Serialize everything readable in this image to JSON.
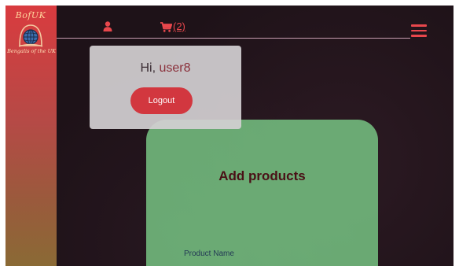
{
  "brand": {
    "logo_top": "BofUK",
    "logo_sub": "Bengalis of the UK"
  },
  "nav": {
    "user_icon": "user-icon",
    "cart_icon": "cart-icon",
    "cart_count": "(2)",
    "menu_icon": "hamburger-menu-icon",
    "accent_color": "#e8474c"
  },
  "user_popup": {
    "greeting_prefix": "Hi, ",
    "username": "user8",
    "logout_label": "Logout"
  },
  "main": {
    "title": "Add products",
    "fields": {
      "product_name_label": "Product Name"
    }
  },
  "colors": {
    "sidebar_top": "#d93b3f",
    "sidebar_bottom": "#8a6a35",
    "card": "#74be80",
    "logout_button": "#d2373f"
  }
}
